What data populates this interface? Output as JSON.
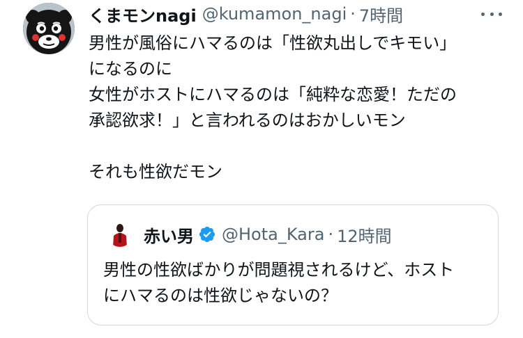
{
  "tweet": {
    "author_name": "くまモンnagi",
    "author_handle": "@kumamon_nagi",
    "separator": "·",
    "time": "7時間",
    "avatar_icon": "kumamon-avatar-icon",
    "more_icon": "more-dots-icon",
    "lines": [
      "男性が風俗にハマるのは「性欲丸出しでキモい」",
      "になるのに",
      "女性がホストにハマるのは「純粋な恋愛！ただの",
      "承認欲求！」と言われるのはおかしいモン",
      "",
      "それも性欲だモン"
    ]
  },
  "quoted_tweet": {
    "author_name": "赤い男",
    "verified_icon": "verified-badge-icon",
    "verified_color": "#1d9bf0",
    "author_handle": "@Hota_Kara",
    "separator": "·",
    "time": "12時間",
    "lines": [
      "男性の性欲ばかりが問題視されるけど、ホスト",
      "にハマるのは性欲じゃないの？"
    ]
  },
  "colors": {
    "text": "#0f1419",
    "secondary": "#536471",
    "border": "#cfd9de"
  }
}
